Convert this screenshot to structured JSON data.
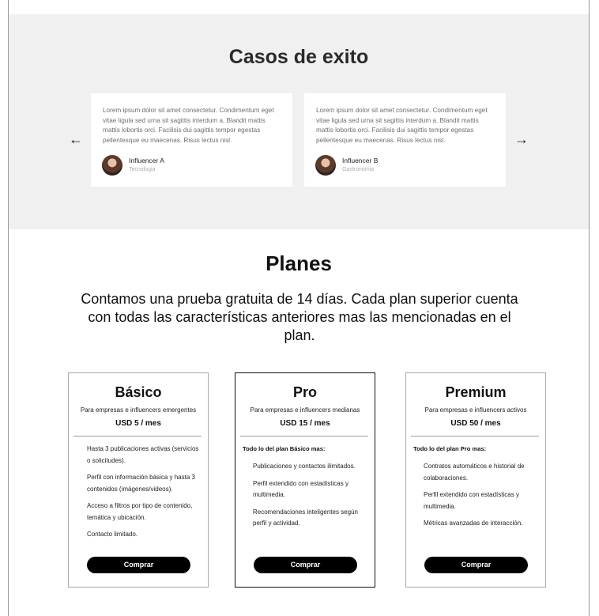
{
  "cases": {
    "title": "Casos de exito",
    "prev_arrow": "←",
    "next_arrow": "→",
    "testimonials": [
      {
        "text": "Lorem ipsum dolor sit amet consectetur. Condimentum eget vitae ligula sed urna sit sagittis interdum a. Blandit mattis mattis lobortis orci. Facilisis dui sagittis tempor egestas pellentesque eu maecenas. Risus lectus nisl.",
        "name": "Influencer A",
        "category": "Tecnologia"
      },
      {
        "text": "Lorem ipsum dolor sit amet consectetur. Condimentum eget vitae ligula sed urna sit sagittis interdum a. Blandit mattis mattis lobortis orci. Facilisis dui sagittis tempor egestas pellentesque eu maecenas. Risus lectus nisl.",
        "name": "Influencer B",
        "category": "Gastronomia"
      }
    ]
  },
  "plans": {
    "title": "Planes",
    "subtitle": "Contamos una prueba gratuita de 14 días. Cada plan superior cuenta con todas las características anteriores mas las mencionadas en el plan.",
    "items": [
      {
        "name": "Básico",
        "description": "Para empresas e influencers emergentes",
        "price": "USD 5  / mes",
        "intro": "",
        "features": [
          "Hasta 3 publicaciones activas (servicios o solicitudes).",
          "Perfil con información básica y hasta 3 contenidos (imágenes/videos).",
          "Acceso a filtros por tipo de contenido, temática y ubicación.",
          "Contacto limitado."
        ],
        "button": "Comprar"
      },
      {
        "name": "Pro",
        "description": "Para empresas e influencers medianas",
        "price": "USD 15  / mes",
        "intro": "Todo lo del plan Básico mas:",
        "features": [
          "Publicaciones y contactos ilimitados.",
          "Perfil extendido con estadísticas y multimedia.",
          "Recomendaciones inteligentes según perfil y actividad."
        ],
        "button": "Comprar"
      },
      {
        "name": "Premium",
        "description": "Para empresas e influencers activos",
        "price": "USD 50  / mes",
        "intro": "Todo lo del plan Pro mas:",
        "features": [
          "Contratos automáticos e historial de colaboraciones.",
          "Perfil extendido con estadísticas y multimedia.",
          "Métricas avanzadas de interacción."
        ],
        "button": "Comprar"
      }
    ]
  }
}
